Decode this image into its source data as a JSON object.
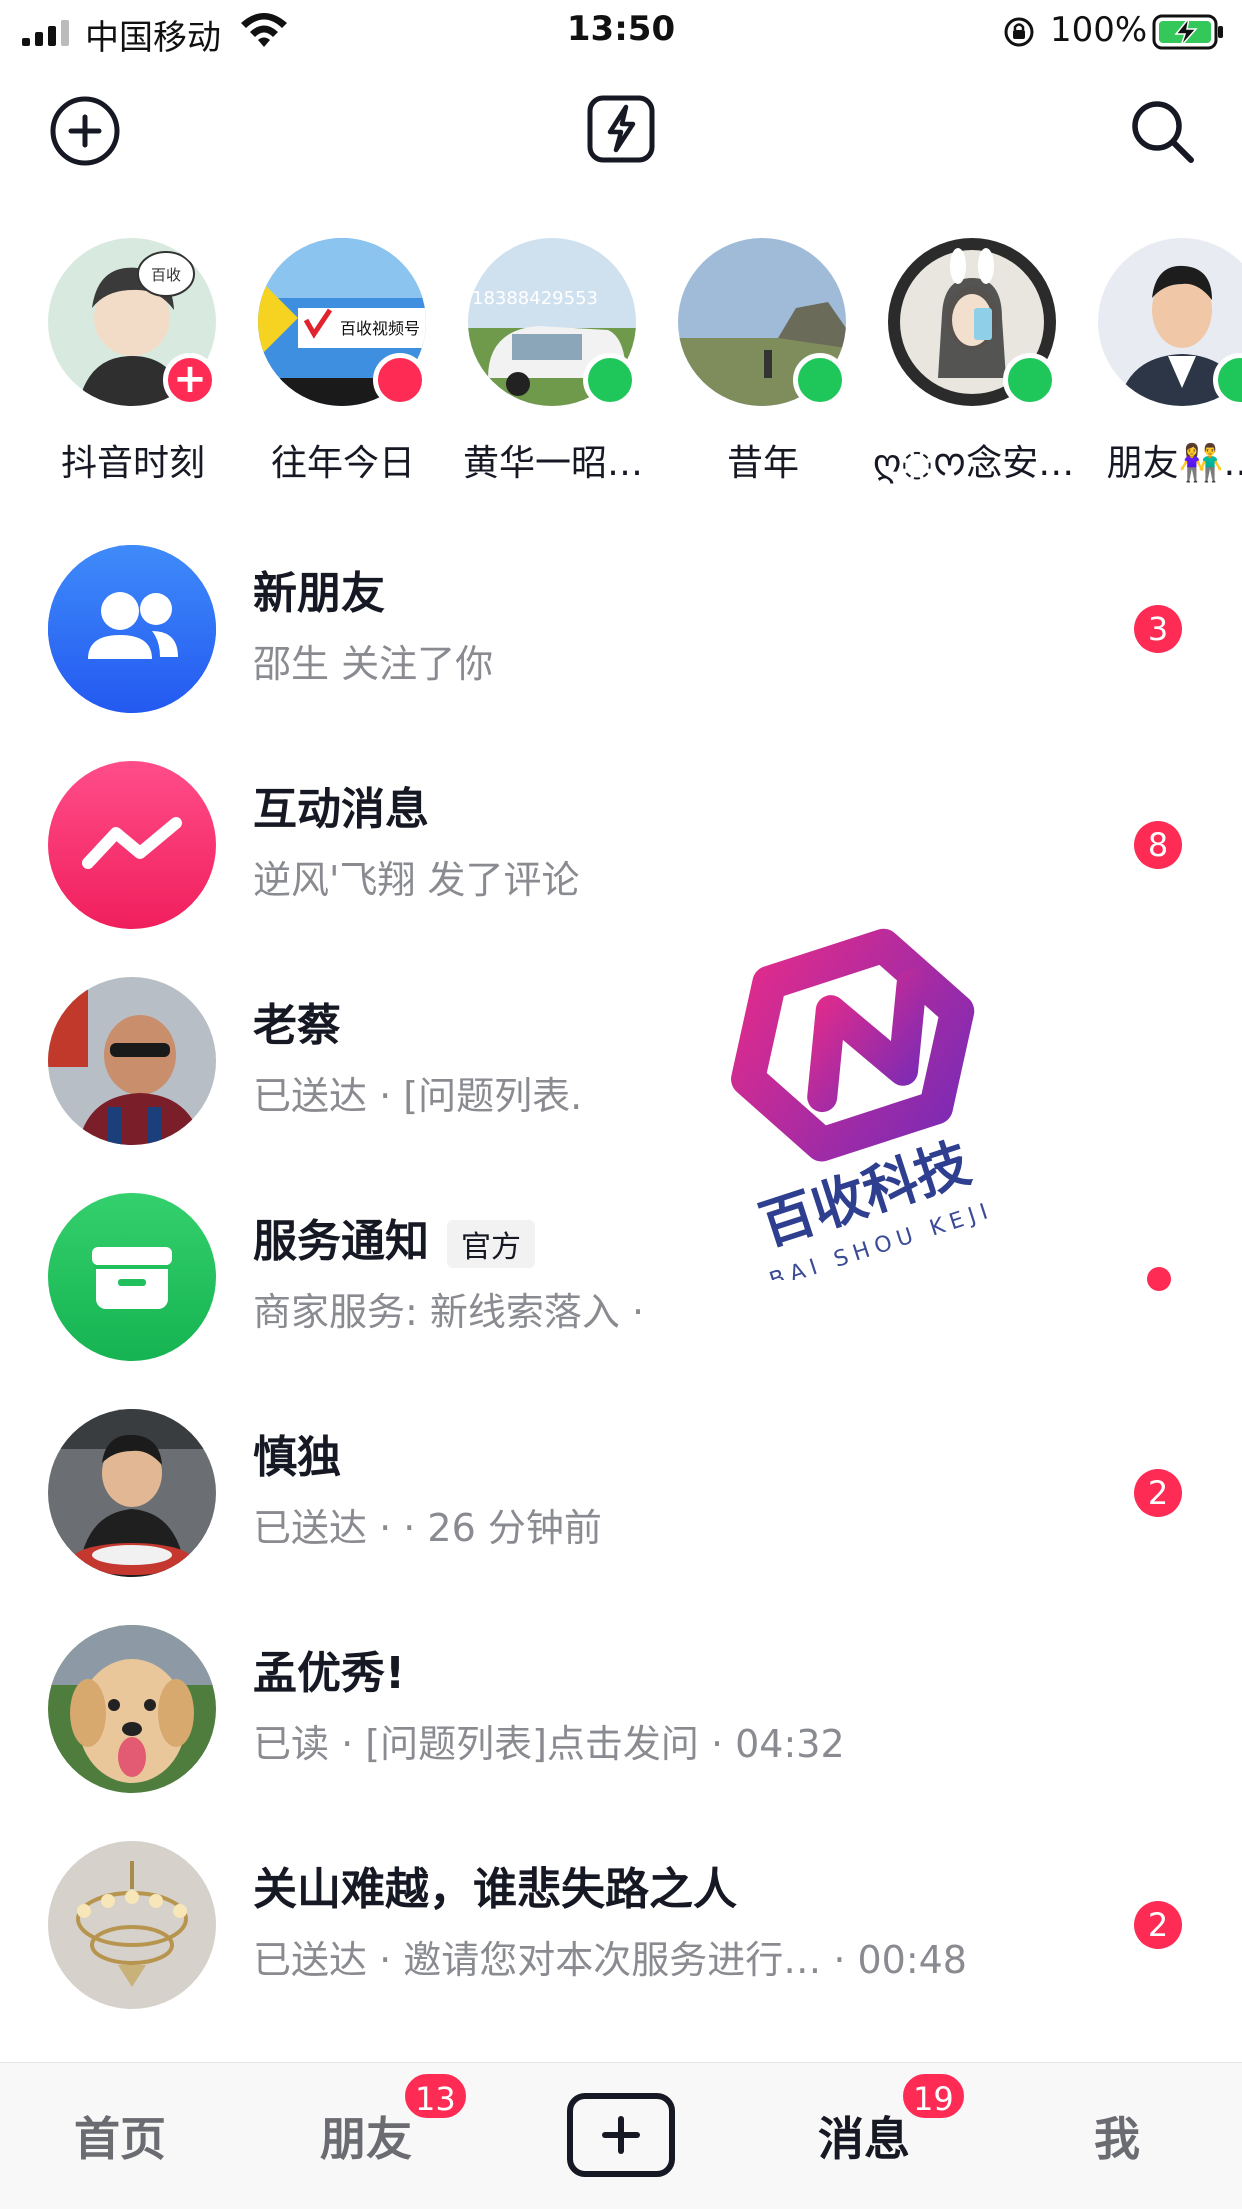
{
  "status_bar": {
    "carrier": "中国移动",
    "time": "13:50",
    "battery": "100%"
  },
  "top_nav": {
    "left_icon": "add-icon",
    "center_icon": "flash-icon",
    "right_icon": "search-icon"
  },
  "stories": [
    {
      "name": "抖音时刻",
      "status": "plus"
    },
    {
      "name": "往年今日",
      "status": "red"
    },
    {
      "name": "黄华一昭…",
      "status": "green"
    },
    {
      "name": "昔年",
      "status": "green"
    },
    {
      "name": "ღ◌ᰔ念安…",
      "status": "green"
    },
    {
      "name": "朋友👫…",
      "status": "green"
    }
  ],
  "messages": [
    {
      "title": "新朋友",
      "subtitle": "邵生 关注了你",
      "badge": "3"
    },
    {
      "title": "互动消息",
      "subtitle": "逆风'飞翔 发了评论",
      "badge": "8"
    },
    {
      "title": "老蔡",
      "subtitle": "已送达 · [问题列表.",
      "badge": ""
    },
    {
      "title": "服务通知",
      "tag": "官方",
      "subtitle": "商家服务:  新线索落入 ·",
      "badge": "dot"
    },
    {
      "title": "慎独",
      "subtitle": "已送达 ·  · 26 分钟前",
      "badge": "2"
    },
    {
      "title": "孟优秀!",
      "subtitle": "已读 · [问题列表]点击发问 · 04:32",
      "badge": ""
    },
    {
      "title": "关山难越，谁悲失路之人",
      "subtitle": "已送达 · 邀请您对本次服务进行…   · 00:48",
      "badge": "2"
    }
  ],
  "watermark": {
    "brand": "百收科技",
    "pinyin": "BAI SHOU KEJI"
  },
  "tabbar": {
    "home": "首页",
    "friends": "朋友",
    "friends_badge": "13",
    "messages": "消息",
    "messages_badge": "19",
    "me": "我"
  },
  "colors": {
    "accent_red": "#fe2c55",
    "online_green": "#1fc75a",
    "new_friends_blue": "#2f6ef6",
    "interaction_pink": "#fe2c6b",
    "service_green": "#23c35e"
  }
}
